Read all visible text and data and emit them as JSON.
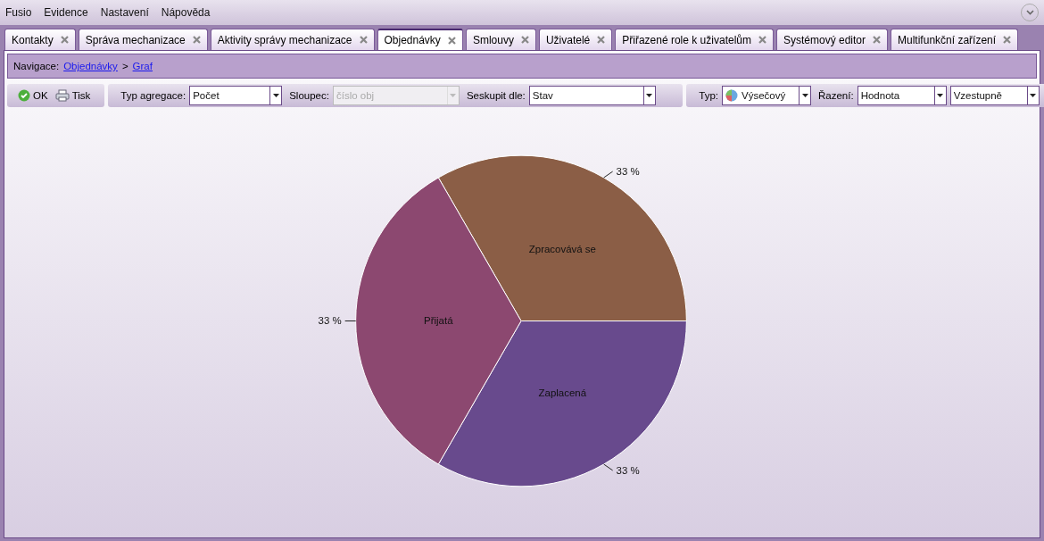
{
  "menu": [
    "Fusio",
    "Evidence",
    "Nastavení",
    "Nápověda"
  ],
  "tabs": [
    {
      "label": "Kontakty",
      "selected": false
    },
    {
      "label": "Správa mechanizace",
      "selected": false
    },
    {
      "label": "Aktivity správy mechanizace",
      "selected": false
    },
    {
      "label": "Objednávky",
      "selected": true
    },
    {
      "label": "Smlouvy",
      "selected": false
    },
    {
      "label": "Uživatelé",
      "selected": false
    },
    {
      "label": "Přiřazené role k uživatelům",
      "selected": false
    },
    {
      "label": "Systémový editor",
      "selected": false
    },
    {
      "label": "Multifunkční zařízení",
      "selected": false
    }
  ],
  "navigation": {
    "label": "Navigace:",
    "links": [
      "Objednávky",
      "Graf"
    ],
    "separator": ">"
  },
  "toolbar": {
    "buttons": [
      {
        "kind": "ok",
        "label": "OK"
      },
      {
        "kind": "print",
        "label": "Tisk"
      }
    ],
    "fields": [
      {
        "label": "Typ agregace:",
        "value": "Počet",
        "disabled": false
      },
      {
        "label": "Sloupec:",
        "value": "číslo obj",
        "disabled": true
      },
      {
        "label": "Seskupit dle:",
        "value": "Stav",
        "disabled": false
      }
    ],
    "chart_fields": [
      {
        "label": "Typ:",
        "value": "Výsečový",
        "kind": "pie"
      },
      {
        "label": "Řazení:",
        "value": "Hodnota",
        "kind": "plain"
      },
      {
        "value": "Vzestupně",
        "kind": "plain"
      }
    ]
  },
  "chart_data": {
    "type": "pie",
    "categories": [
      "Zpracovává se",
      "Zaplacená",
      "Přijatá"
    ],
    "series": [
      {
        "values": [
          33,
          33,
          33
        ]
      }
    ],
    "colors": [
      "#8b5e46",
      "#684a8d",
      "#8c4870"
    ],
    "data_labels": "value_labels",
    "value_labels": [
      "33 %",
      "33 %",
      "33 %"
    ]
  }
}
